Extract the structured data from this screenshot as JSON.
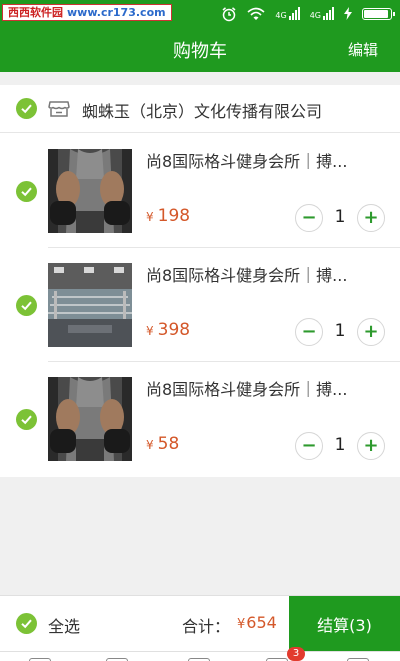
{
  "status_bar": {
    "watermark_site": "西西软件园",
    "watermark_url": "www.cr173.com",
    "signal_label_1": "4G",
    "signal_label_2": "4G",
    "battery_level_percent": 95
  },
  "header": {
    "title": "购物车",
    "edit_label": "编辑"
  },
  "shop": {
    "name": "蜘蛛玉（北京）文化传播有限公司",
    "selected": true
  },
  "items": [
    {
      "name": "尚8国际格斗健身会所｜搏...",
      "currency": "¥",
      "price": "198",
      "quantity": "1",
      "minus_label": "−",
      "plus_label": "+",
      "selected": true,
      "image": "boxer-photo"
    },
    {
      "name": "尚8国际格斗健身会所｜搏...",
      "currency": "¥",
      "price": "398",
      "quantity": "1",
      "minus_label": "−",
      "plus_label": "+",
      "selected": true,
      "image": "boxing-ring-photo"
    },
    {
      "name": "尚8国际格斗健身会所｜搏...",
      "currency": "¥",
      "price": "58",
      "quantity": "1",
      "minus_label": "−",
      "plus_label": "+",
      "selected": true,
      "image": "boxer-photo"
    }
  ],
  "footer": {
    "select_all_label": "全选",
    "total_label": "合计：",
    "total_currency": "¥",
    "total_value": "654",
    "checkout_label": "结算(3)"
  },
  "tab_bar": {
    "badge_count": "3"
  },
  "colors": {
    "brand_green": "#1f9a1f",
    "check_green": "#7cc236",
    "price_orange": "#d4582a",
    "badge_red": "#e23b2e"
  }
}
